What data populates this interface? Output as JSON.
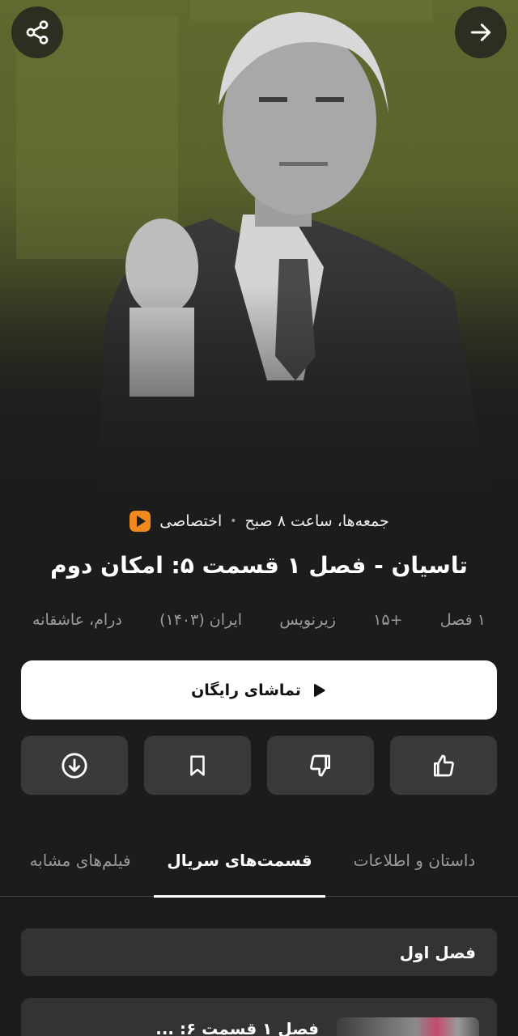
{
  "hero": {
    "share_icon": "share-icon",
    "back_icon": "arrow-right-icon"
  },
  "meta": {
    "brand_icon": "play-logo-icon",
    "exclusive": "اختصاصی",
    "schedule": "جمعه‌ها، ساعت ۸ صبح"
  },
  "title": "تاسیان - فصل ۱ قسمت ۵: امکان دوم",
  "tags": {
    "seasons": "۱ فصل",
    "age": "+۱۵",
    "subtitle": "زیرنویس",
    "country_year": "ایران (۱۴۰۳)",
    "genres": "درام، عاشقانه"
  },
  "cta": {
    "label": "تماشای رایگان",
    "icon": "play-icon"
  },
  "actions": {
    "like_icon": "thumbs-up-icon",
    "dislike_icon": "thumbs-down-icon",
    "bookmark_icon": "bookmark-icon",
    "download_icon": "download-icon"
  },
  "tabs": [
    {
      "label": "داستان و اطلاعات"
    },
    {
      "label": "قسمت‌های سریال"
    },
    {
      "label": "فیلم‌های مشابه"
    }
  ],
  "season_label": "فصل اول",
  "episode_title": "فصل ۱ قسمت ۶: ...",
  "colors": {
    "background": "#1c1c1c",
    "hero_tint": "#5f6a2f",
    "button_bg": "#3a3a3a",
    "cta_bg": "#ffffff",
    "brand_orange": "#f08a1c"
  }
}
